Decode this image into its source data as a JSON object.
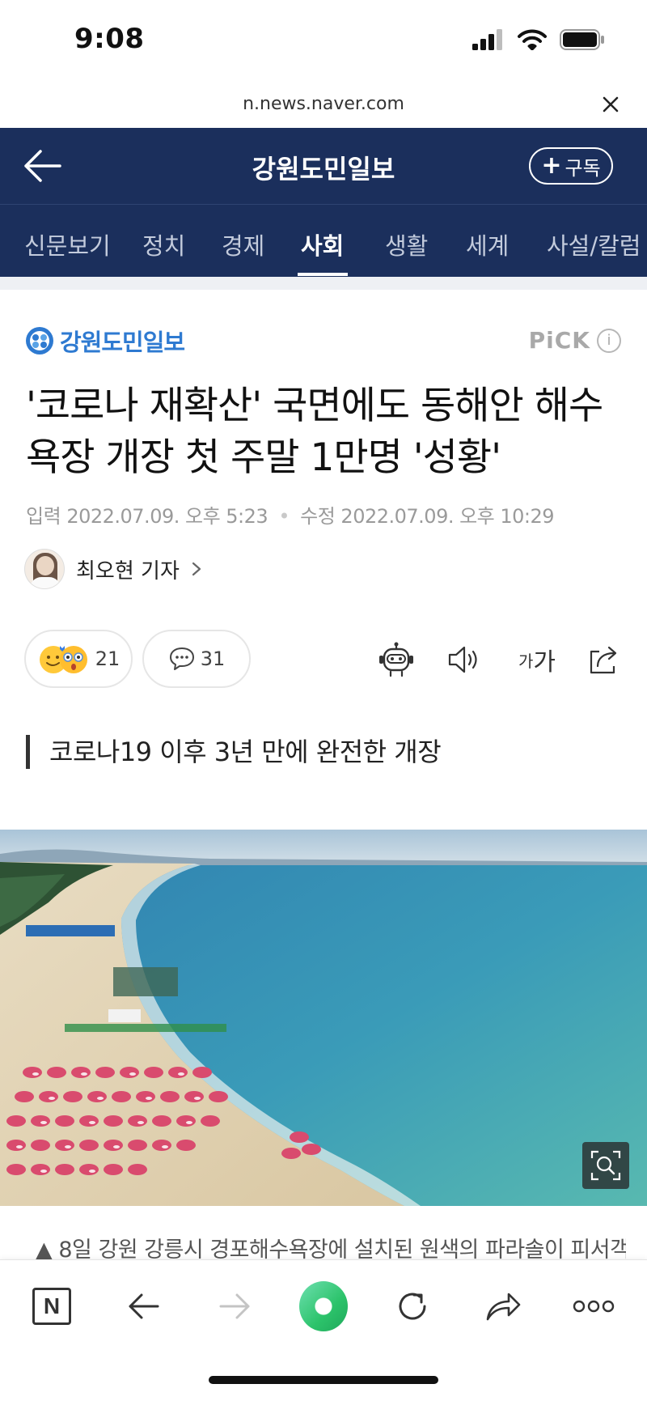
{
  "status": {
    "time": "9:08"
  },
  "browser": {
    "url": "n.news.naver.com"
  },
  "header": {
    "title": "강원도민일보",
    "subscribe_label": "구독"
  },
  "nav": {
    "tabs": [
      {
        "label": "신문보기"
      },
      {
        "label": "정치"
      },
      {
        "label": "경제"
      },
      {
        "label": "사회",
        "active": true
      },
      {
        "label": "생활"
      },
      {
        "label": "세계"
      },
      {
        "label": "사설/칼럼"
      }
    ]
  },
  "article": {
    "press_name": "강원도민일보",
    "pick_label": "PiCK",
    "pick_info": "i",
    "headline": "'코로나 재확산' 국면에도 동해안 해수욕장 개장 첫 주말 1만명 '성황'",
    "input_label": "입력",
    "input_date": "2022.07.09. 오후 5:23",
    "modified_label": "수정",
    "modified_date": "2022.07.09. 오후 10:29",
    "reporter": "최오현 기자",
    "reactions_count": "21",
    "comments_count": "31",
    "font_small": "가",
    "font_large": "가",
    "subheadline": "코로나19 이후 3년 만에 완전한 개장",
    "caption": "▲ 8일 강원 강릉시 경포해수욕장에 설치된 원색의 파라솔이 피서객"
  },
  "bottom_bar": {
    "n_label": "N"
  }
}
